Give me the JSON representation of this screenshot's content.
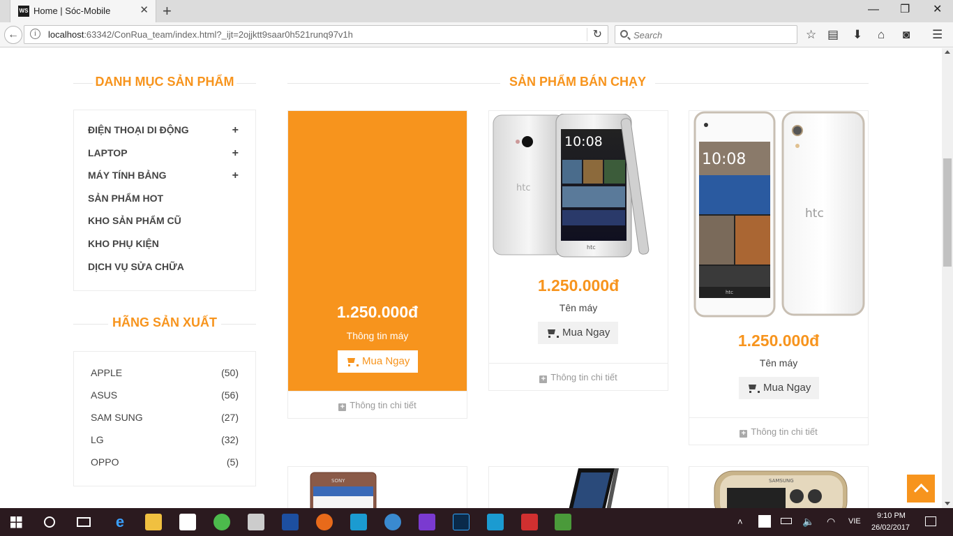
{
  "browser": {
    "tab_title": "Home | Sóc-Mobile",
    "favicon_text": "WS",
    "url_host": "localhost",
    "url_rest": ":63342/ConRua_team/index.html?_ijt=2ojjktt9saar0h521runq97v1h",
    "search_placeholder": "Search"
  },
  "sidebar": {
    "categories_title": "DANH MỤC SẢN PHẨM",
    "categories": [
      {
        "label": "ĐIỆN THOẠI DI ĐỘNG",
        "expand": "+"
      },
      {
        "label": "LAPTOP",
        "expand": "+"
      },
      {
        "label": "MÁY TÍNH BẢNG",
        "expand": "+"
      },
      {
        "label": "SẢN PHẨM HOT",
        "expand": ""
      },
      {
        "label": "KHO SẢN PHẨM CŨ",
        "expand": ""
      },
      {
        "label": "KHO PHỤ KIỆN",
        "expand": ""
      },
      {
        "label": "DỊCH VỤ SỬA CHỮA",
        "expand": ""
      }
    ],
    "brands_title": "HÃNG SẢN XUẤT",
    "brands": [
      {
        "name": "APPLE",
        "count": "(50)"
      },
      {
        "name": "ASUS",
        "count": "(56)"
      },
      {
        "name": "SAM SUNG",
        "count": "(27)"
      },
      {
        "name": "LG",
        "count": "(32)"
      },
      {
        "name": "OPPO",
        "count": "(5)"
      }
    ]
  },
  "main": {
    "title": "SẢN PHẨM BÁN CHẠY",
    "products": [
      {
        "price": "1.250.000đ",
        "name": "Thông tin máy",
        "buy_label": "Mua Ngay",
        "detail_label": "Thông tin chi tiết",
        "image": "featured-orange"
      },
      {
        "price": "1.250.000đ",
        "name": "Tên máy",
        "buy_label": "Mua Ngay",
        "detail_label": "Thông tin chi tiết",
        "image": "htc-one-silver",
        "screen_time": "10:08",
        "brand_mark": "htc"
      },
      {
        "price": "1.250.000đ",
        "name": "Tên máy",
        "buy_label": "Mua Ngay",
        "detail_label": "Thông tin chi tiết",
        "image": "htc-desire-white",
        "screen_time": "10:08",
        "brand_mark": "htc"
      }
    ],
    "row2_images": [
      "sony-xperia-copper",
      "sony-xperia-black",
      "samsung-galaxy-gold"
    ],
    "row2_brand_marks": [
      "SONY",
      "SAMSUNG"
    ]
  },
  "taskbar": {
    "time": "9:10 PM",
    "date": "26/02/2017",
    "lang": "VIE"
  },
  "colors": {
    "accent": "#f7941d",
    "taskbar": "#2b1a1f"
  }
}
